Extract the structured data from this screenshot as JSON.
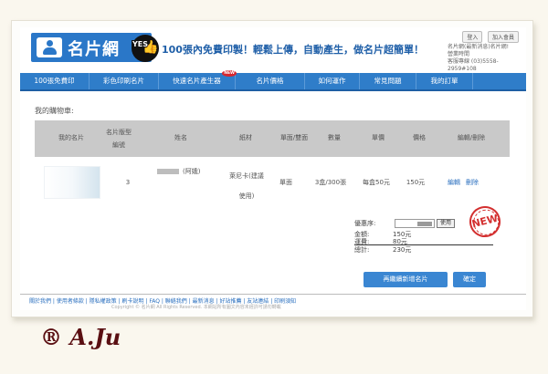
{
  "header": {
    "logo_text": "名片網",
    "badge_text": "YES",
    "slogan": "100張內免費印製！輕鬆上傳，自動產生，做名片超簡單！",
    "top_links": [
      "登入",
      "加入會員"
    ],
    "contact": [
      "名片網(最新消息)名片網!",
      "營業時間",
      "客服專線 (03)5558-2959#108"
    ]
  },
  "nav": {
    "items": [
      {
        "label": "100張免費印"
      },
      {
        "label": "彩色印刷名片"
      },
      {
        "label": "快速名片產生器",
        "tag": "NEW"
      },
      {
        "label": "名片價格"
      },
      {
        "label": "如何運作"
      },
      {
        "label": "常見問題"
      },
      {
        "label": "我的訂單"
      }
    ]
  },
  "cart": {
    "title": "我的購物車:",
    "columns": [
      "我的名片",
      "名片版型編號",
      "姓名",
      "紙材",
      "單面/雙面",
      "數量",
      "單價",
      "價格",
      "編輯/刪除"
    ],
    "row": {
      "template_no": "3",
      "name": "(阿娥)",
      "paper": "萊尼卡(建議使用)",
      "sides": "單面",
      "quantity": "3盒/300張",
      "unit_price": "每盒50元",
      "price": "150元",
      "edit": "編輯",
      "delete": "刪除"
    }
  },
  "summary": {
    "redeem_label": "優惠序:",
    "redeem_button": "使用",
    "rows": [
      {
        "label": "金額:",
        "value": "150元"
      },
      {
        "label": "運費:",
        "value": "80元"
      },
      {
        "label": "總計:",
        "value": "230元"
      }
    ],
    "stamp_text": "NEW"
  },
  "actions": {
    "continue_label": "再繼續新增名片",
    "confirm_label": "確定"
  },
  "footer": {
    "links": "關於我們 | 使用者條款 | 隱私權政策 | 刷卡說明 | FAQ | 聯絡我們 | 最新消息 | 好站推薦 | 友站連結 | 印刷須知",
    "copyright": "Copyright © 名片網 All Rights Reserved. 本網站所有圖文內容未經許可請勿轉載"
  },
  "signature": "® A.Ju",
  "colors": {
    "primary": "#2f7dc9",
    "header_blue": "#2a77c8",
    "table_header": "#c9c9c9",
    "stamp_red": "#d32f2f"
  }
}
